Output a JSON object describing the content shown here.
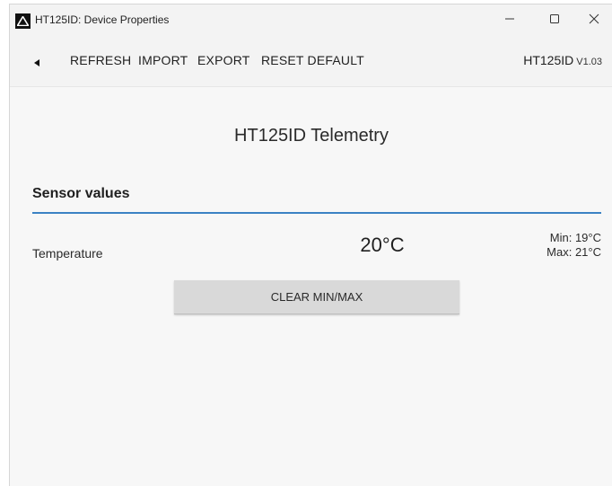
{
  "window": {
    "title": "HT125ID: Device Properties",
    "controls": {
      "minimize": "minimize-icon",
      "maximize": "maximize-icon",
      "close": "close-icon"
    }
  },
  "toolbar": {
    "back_icon": "back-triangle-icon",
    "refresh_label": "REFRESH",
    "import_label": "IMPORT",
    "export_label": "EXPORT",
    "reset_label": "RESET DEFAULT",
    "device_name": "HT125ID",
    "device_version": "V1.03"
  },
  "main": {
    "title": "HT125ID Telemetry",
    "section_title": "Sensor values",
    "accent_color": "#3b82c4",
    "sensor": {
      "label": "Temperature",
      "value": "20°C",
      "min": "Min: 19°C",
      "max": "Max: 21°C"
    },
    "clear_button_label": "CLEAR MIN/MAX"
  }
}
